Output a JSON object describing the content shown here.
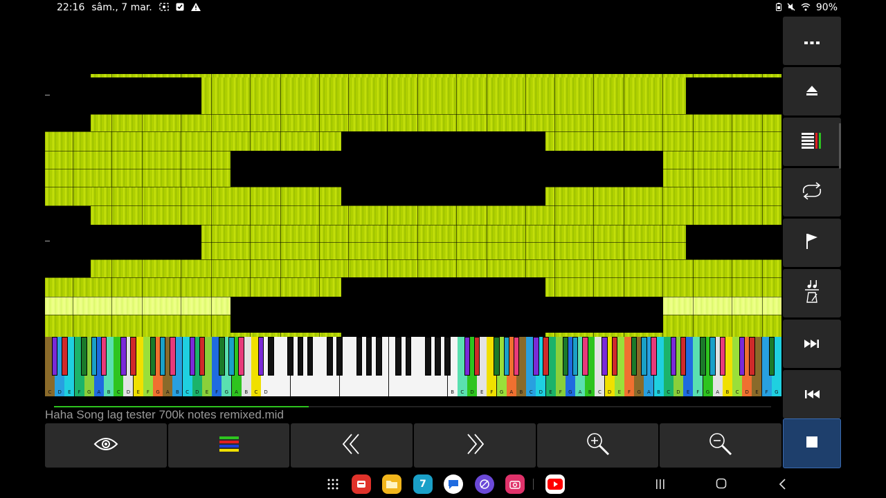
{
  "status_bar": {
    "time": "22:16",
    "date": "sâm., 7 mar.",
    "battery": "90%",
    "icons_left": [
      "screenshot-icon",
      "checkbox-icon",
      "warning-icon"
    ],
    "icons_right": [
      "battery-saver-icon",
      "mute-icon",
      "wifi-icon",
      "battery-icon"
    ]
  },
  "player": {
    "file_name": "Haha Song lag tester 700k notes remixed.mid",
    "progress": 0.355,
    "note_color": "#b4d400"
  },
  "keyboard": {
    "white_key_labels": [
      "C",
      "D",
      "E",
      "F",
      "G",
      "A",
      "B"
    ]
  },
  "bottom_toolbar": [
    {
      "name": "eye-button",
      "icon": "eye-icon"
    },
    {
      "name": "color-bars-button",
      "icon": "color-bars-icon"
    },
    {
      "name": "rewind-page-button",
      "icon": "double-chevron-left-icon"
    },
    {
      "name": "forward-page-button",
      "icon": "double-chevron-right-icon"
    },
    {
      "name": "zoom-in-button",
      "icon": "zoom-in-icon"
    },
    {
      "name": "zoom-out-button",
      "icon": "zoom-out-icon"
    }
  ],
  "right_toolbar": [
    {
      "name": "more-button",
      "icon": "more-icon"
    },
    {
      "name": "eject-button",
      "icon": "eject-icon"
    },
    {
      "name": "tracks-button",
      "icon": "tracks-icon"
    },
    {
      "name": "loop-button",
      "icon": "loop-icon"
    },
    {
      "name": "flag-button",
      "icon": "flag-icon"
    },
    {
      "name": "metronome-button",
      "icon": "metronome-icon"
    },
    {
      "name": "skip-next-button",
      "icon": "skip-next-icon"
    },
    {
      "name": "skip-previous-button",
      "icon": "skip-previous-icon"
    },
    {
      "name": "stop-button",
      "icon": "stop-icon"
    }
  ],
  "nav_bar": {
    "dock_apps": [
      "apps-grid-icon",
      "app-red-icon",
      "app-folder-icon",
      "calendar-app-icon",
      "messages-app-icon",
      "browser-app-icon",
      "camera-app-icon",
      "youtube-app-icon"
    ],
    "calendar_day": "7"
  }
}
